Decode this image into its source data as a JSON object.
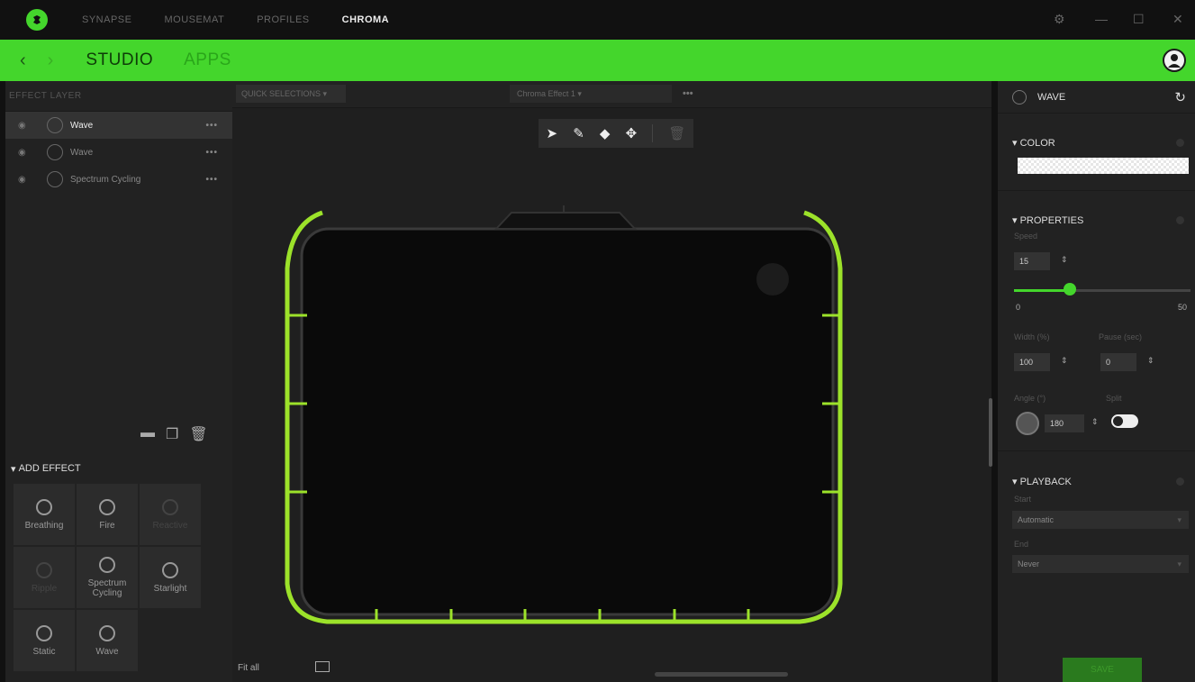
{
  "nav": {
    "tabs": [
      "SYNAPSE",
      "MOUSEMAT",
      "PROFILES",
      "CHROMA"
    ],
    "active": "CHROMA",
    "window_controls": [
      "gear-icon",
      "minimize-icon",
      "maximize-icon",
      "close-icon"
    ]
  },
  "subnav": {
    "back_icon": "chevron-left-icon",
    "forward_icon": "chevron-right-icon",
    "tabs": [
      "STUDIO",
      "APPS"
    ]
  },
  "left_panel": {
    "header": "EFFECT LAYER",
    "layers": [
      {
        "name": "Wave",
        "selected": true
      },
      {
        "name": "Wave",
        "selected": false
      },
      {
        "name": "Spectrum Cycling",
        "selected": false
      }
    ],
    "add_effect": {
      "title": "ADD EFFECT",
      "effects": [
        {
          "label": "Breathing",
          "enabled": true
        },
        {
          "label": "Fire",
          "enabled": true
        },
        {
          "label": "Reactive",
          "enabled": false
        },
        {
          "label": "Ripple",
          "enabled": false
        },
        {
          "label": "Spectrum Cycling",
          "enabled": true
        },
        {
          "label": "Starlight",
          "enabled": true
        },
        {
          "label": "Static",
          "enabled": true
        },
        {
          "label": "Wave",
          "enabled": true
        }
      ]
    }
  },
  "center": {
    "quick_selections": "QUICK SELECTIONS",
    "effect_name": "Chroma Effect 1",
    "fit_label": "Fit all",
    "pad_accent": "#44d62c"
  },
  "right_panel": {
    "effect": "WAVE",
    "color_title": "COLOR",
    "properties_title": "PROPERTIES",
    "speed_label": "Speed",
    "speed_value": "15",
    "speed_min": "0",
    "speed_max": "50",
    "speed_fraction": 0.3,
    "width_label": "Width (%)",
    "width_value": "100",
    "pause_label": "Pause (sec)",
    "pause_value": "0",
    "angle_label": "Angle (°)",
    "angle_value": "180",
    "split_label": "Split",
    "split_on": true,
    "playback_title": "PLAYBACK",
    "start_label": "Start",
    "start_value": "Automatic",
    "end_label": "End",
    "end_value": "Never",
    "save_label": "SAVE"
  },
  "colors": {
    "accent": "#44d62c",
    "background": "#111111",
    "panel": "#222222"
  }
}
